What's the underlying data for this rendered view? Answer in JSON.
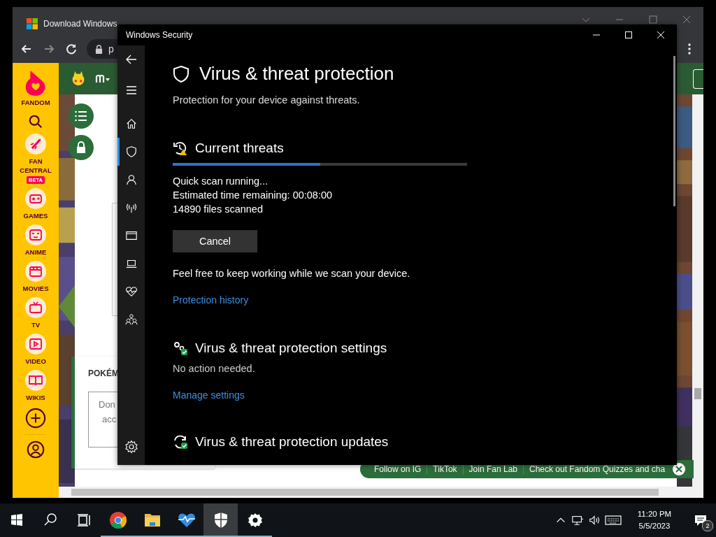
{
  "browser": {
    "tabs": [
      {
        "label": "Download Windows",
        "selected": true
      }
    ],
    "address": "p",
    "sidebar": {
      "brand": "FANDOM",
      "items": [
        {
          "label": "FAN CENTRAL",
          "badge": "BETA"
        },
        {
          "label": "GAMES"
        },
        {
          "label": "ANIME"
        },
        {
          "label": "MOVIES"
        },
        {
          "label": "TV"
        },
        {
          "label": "VIDEO"
        },
        {
          "label": "WIKIS"
        }
      ]
    },
    "card": {
      "heading": "POKÉM",
      "lines": [
        "Don",
        "acc"
      ]
    },
    "banner": {
      "links": [
        "Follow on IG",
        "TikTok",
        "Join Fan Lab",
        "Check out Fandom Quizzes and cha"
      ]
    }
  },
  "security": {
    "title": "Windows Security",
    "nav": [
      {
        "selected": false
      },
      {
        "selected": true
      },
      {
        "selected": false
      },
      {
        "selected": false
      },
      {
        "selected": false
      },
      {
        "selected": false
      },
      {
        "selected": false
      },
      {
        "selected": false
      }
    ],
    "heading": "Virus & threat protection",
    "subtitle": "Protection for your device against threats.",
    "scan": {
      "title": "Current threats",
      "level": 0.5,
      "lines": [
        "Quick scan running...",
        "Estimated time remaining:  00:08:00",
        "14890  files scanned"
      ],
      "button": "Cancel",
      "note": "Feel free to keep working while we scan your device.",
      "link": "Protection history"
    },
    "sections": [
      {
        "title": "Virus & threat protection settings",
        "status": "No action needed.",
        "link": "Manage settings"
      },
      {
        "title": "Virus & threat protection updates"
      }
    ]
  },
  "taskbar": {
    "apps": [
      {
        "kind": "chrome",
        "active": false
      },
      {
        "kind": "folder",
        "active": false
      },
      {
        "kind": "heart",
        "active": false
      },
      {
        "kind": "shield",
        "active": true
      },
      {
        "kind": "gear",
        "active": false
      }
    ],
    "time": "11:20 PM",
    "date": "5/5/2023",
    "notifications": "2"
  }
}
